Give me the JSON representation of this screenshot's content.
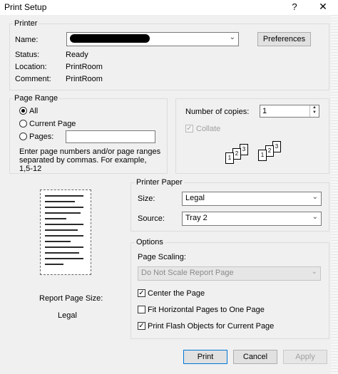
{
  "window": {
    "title": "Print Setup",
    "help_glyph": "?",
    "close_glyph": "✕"
  },
  "printer": {
    "group_label": "Printer",
    "name_label": "Name:",
    "preferences_label": "Preferences",
    "status_label": "Status:",
    "status_value": "Ready",
    "location_label": "Location:",
    "location_value": "PrintRoom",
    "comment_label": "Comment:",
    "comment_value": "PrintRoom"
  },
  "page_range": {
    "group_label": "Page Range",
    "options": [
      "All",
      "Current Page",
      "Pages:"
    ],
    "selected": "All",
    "pages_value": "",
    "hint": "Enter page numbers and/or page ranges separated by commas. For example, 1,5-12"
  },
  "copies": {
    "label": "Number of copies:",
    "value": "1",
    "collate_label": "Collate",
    "collate_checked": true,
    "collate_enabled": false,
    "icon_numbers": [
      "1",
      "2",
      "3"
    ]
  },
  "preview": {
    "size_label": "Report Page Size:",
    "size_value": "Legal"
  },
  "printer_paper": {
    "group_label": "Printer Paper",
    "size_label": "Size:",
    "size_value": "Legal",
    "source_label": "Source:",
    "source_value": "Tray 2"
  },
  "options": {
    "group_label": "Options",
    "scaling_label": "Page Scaling:",
    "scaling_value": "Do Not Scale Report Page",
    "center_label": "Center the Page",
    "center_checked": true,
    "fit_label": "Fit Horizontal Pages to One Page",
    "fit_checked": false,
    "flash_label": "Print Flash Objects for Current Page",
    "flash_checked": true
  },
  "buttons": {
    "print": "Print",
    "cancel": "Cancel",
    "apply": "Apply"
  }
}
